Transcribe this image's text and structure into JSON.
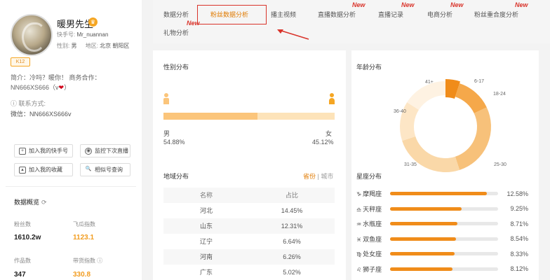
{
  "profile": {
    "name": "暖男先生",
    "handle_label": "快手号:",
    "handle": "Mr_nuannan",
    "gender_label": "性别:",
    "gender": "男",
    "region_label": "地区:",
    "region": "北京 朝阳区",
    "level": "K12",
    "bio_line1": "简介：冷吗？暖你！ 商务合作：",
    "bio_line2": "NN666XS666（v",
    "bio_heart": "❤",
    "bio_end": "）",
    "contact": "联系方式:",
    "wechat": "微信：NN666XS666v"
  },
  "actions": {
    "add_account": "加入我的快手号",
    "monitor_live": "监控下次直播",
    "add_favorite": "加入我的收藏",
    "similar": "相似号查询"
  },
  "overview": {
    "title": "数据概览",
    "fans_label": "粉丝数",
    "fans_value": "1610.2w",
    "index_label": "飞瓜指数",
    "index_value": "1123.1",
    "works_label": "作品数",
    "works_value": "347",
    "goods_label": "带货指数",
    "goods_value": "330.8"
  },
  "tabs": [
    {
      "label": "数据分析",
      "new": false
    },
    {
      "label": "粉丝数据分析",
      "new": false,
      "active": true
    },
    {
      "label": "播主视频",
      "new": true
    },
    {
      "label": "直播数据分析",
      "new": true
    },
    {
      "label": "直播记录",
      "new": true
    },
    {
      "label": "电商分析",
      "new": true
    },
    {
      "label": "粉丝重合度分析",
      "new": true
    },
    {
      "label": "礼物分析",
      "new": true
    }
  ],
  "new_badge": "New",
  "gender": {
    "title": "性别分布",
    "male_label": "男",
    "male_pct": "54.88%",
    "male_value": 54.88,
    "female_label": "女",
    "female_pct": "45.12%"
  },
  "region": {
    "title": "地域分布",
    "toggle_province": "省份",
    "toggle_sep": "|",
    "toggle_city": "城市",
    "col_name": "名称",
    "col_ratio": "占比",
    "rows": [
      {
        "name": "河北",
        "ratio": "14.45%"
      },
      {
        "name": "山东",
        "ratio": "12.31%"
      },
      {
        "name": "辽宁",
        "ratio": "6.64%"
      },
      {
        "name": "河南",
        "ratio": "6.26%"
      },
      {
        "name": "广东",
        "ratio": "5.02%"
      }
    ]
  },
  "age": {
    "title": "年龄分布",
    "labels": [
      "6-17",
      "18-24",
      "25-30",
      "31-35",
      "36-40",
      "41+"
    ],
    "values": [
      5,
      13,
      27,
      25,
      14,
      16
    ],
    "colors": [
      "#f08c1a",
      "#f5a84a",
      "#f7c17a",
      "#fad8a8",
      "#fde6c6",
      "#fef2e2"
    ]
  },
  "zodiac": {
    "title": "星座分布",
    "rows": [
      {
        "icon": "♑",
        "name": "摩羯座",
        "pct": "12.58%",
        "value": 12.58
      },
      {
        "icon": "♎",
        "name": "天秤座",
        "pct": "9.25%",
        "value": 9.25
      },
      {
        "icon": "♒",
        "name": "水瓶座",
        "pct": "8.71%",
        "value": 8.71
      },
      {
        "icon": "♓",
        "name": "双鱼座",
        "pct": "8.54%",
        "value": 8.54
      },
      {
        "icon": "♍",
        "name": "处女座",
        "pct": "8.33%",
        "value": 8.33
      },
      {
        "icon": "♌",
        "name": "狮子座",
        "pct": "8.12%",
        "value": 8.12
      }
    ]
  }
}
